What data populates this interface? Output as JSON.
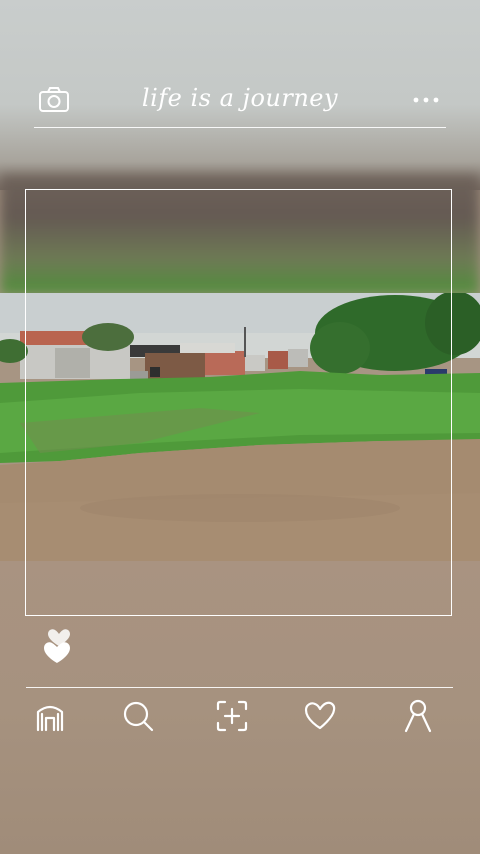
{
  "header": {
    "title": "life is a journey",
    "camera_icon": "camera-icon",
    "more_icon": "more-dots-icon"
  },
  "actions": {
    "like_icon": "heart-icon"
  },
  "nav": [
    {
      "name": "home",
      "icon": "home-icon"
    },
    {
      "name": "search",
      "icon": "search-icon"
    },
    {
      "name": "add",
      "icon": "add-photo-icon"
    },
    {
      "name": "likes",
      "icon": "heart-outline-icon"
    },
    {
      "name": "profile",
      "icon": "profile-icon"
    }
  ],
  "colors": {
    "ui_stroke": "#ffffff",
    "grass": "#4f9a3a",
    "dirt": "#a58b70",
    "sky": "#c9cfd0"
  }
}
